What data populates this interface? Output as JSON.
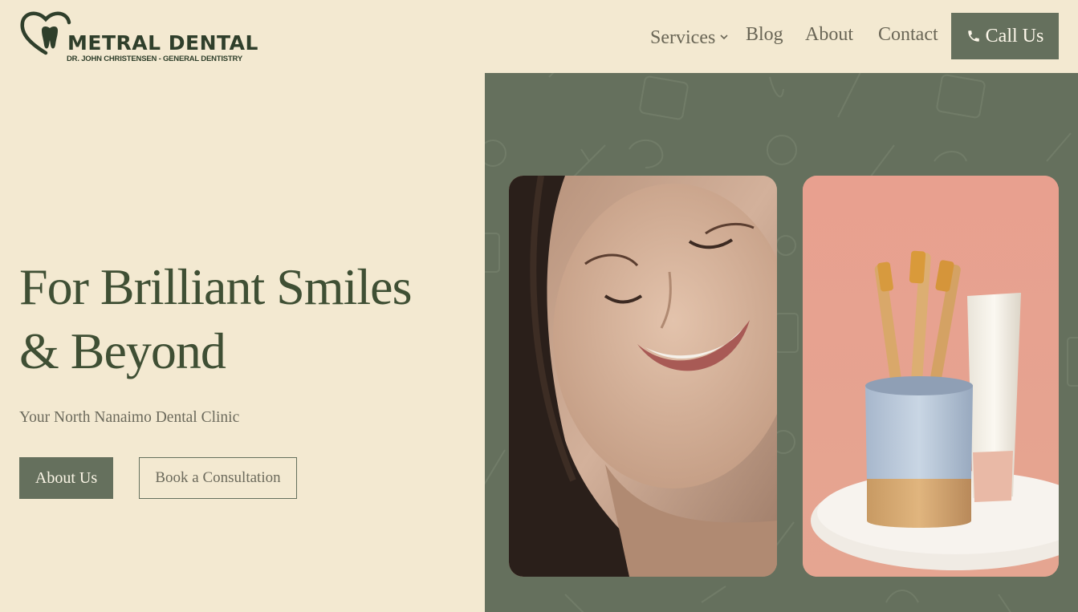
{
  "logo": {
    "name": "METRAL DENTAL",
    "tagline": "DR. JOHN CHRISTENSEN - GENERAL DENTISTRY",
    "icon": "heart-tooth-icon"
  },
  "nav": {
    "items": [
      {
        "label": "Services",
        "has_dropdown": true
      },
      {
        "label": "Blog"
      },
      {
        "label": "About"
      },
      {
        "label": "Contact"
      }
    ],
    "call_button": {
      "label": "Call Us",
      "icon": "phone-icon"
    }
  },
  "hero": {
    "title_line1": "For Brilliant Smiles",
    "title_line2": "& Beyond",
    "subtitle": "Your North Nanaimo Dental Clinic",
    "primary_button": "About Us",
    "secondary_button": "Book a Consultation"
  },
  "images": [
    {
      "name": "smiling-woman-photo"
    },
    {
      "name": "bamboo-toothbrushes-photo"
    }
  ],
  "colors": {
    "background": "#f3e9d1",
    "accent_green": "#65705d",
    "heading": "#3f4f34",
    "body_text": "#6c6a5c"
  }
}
